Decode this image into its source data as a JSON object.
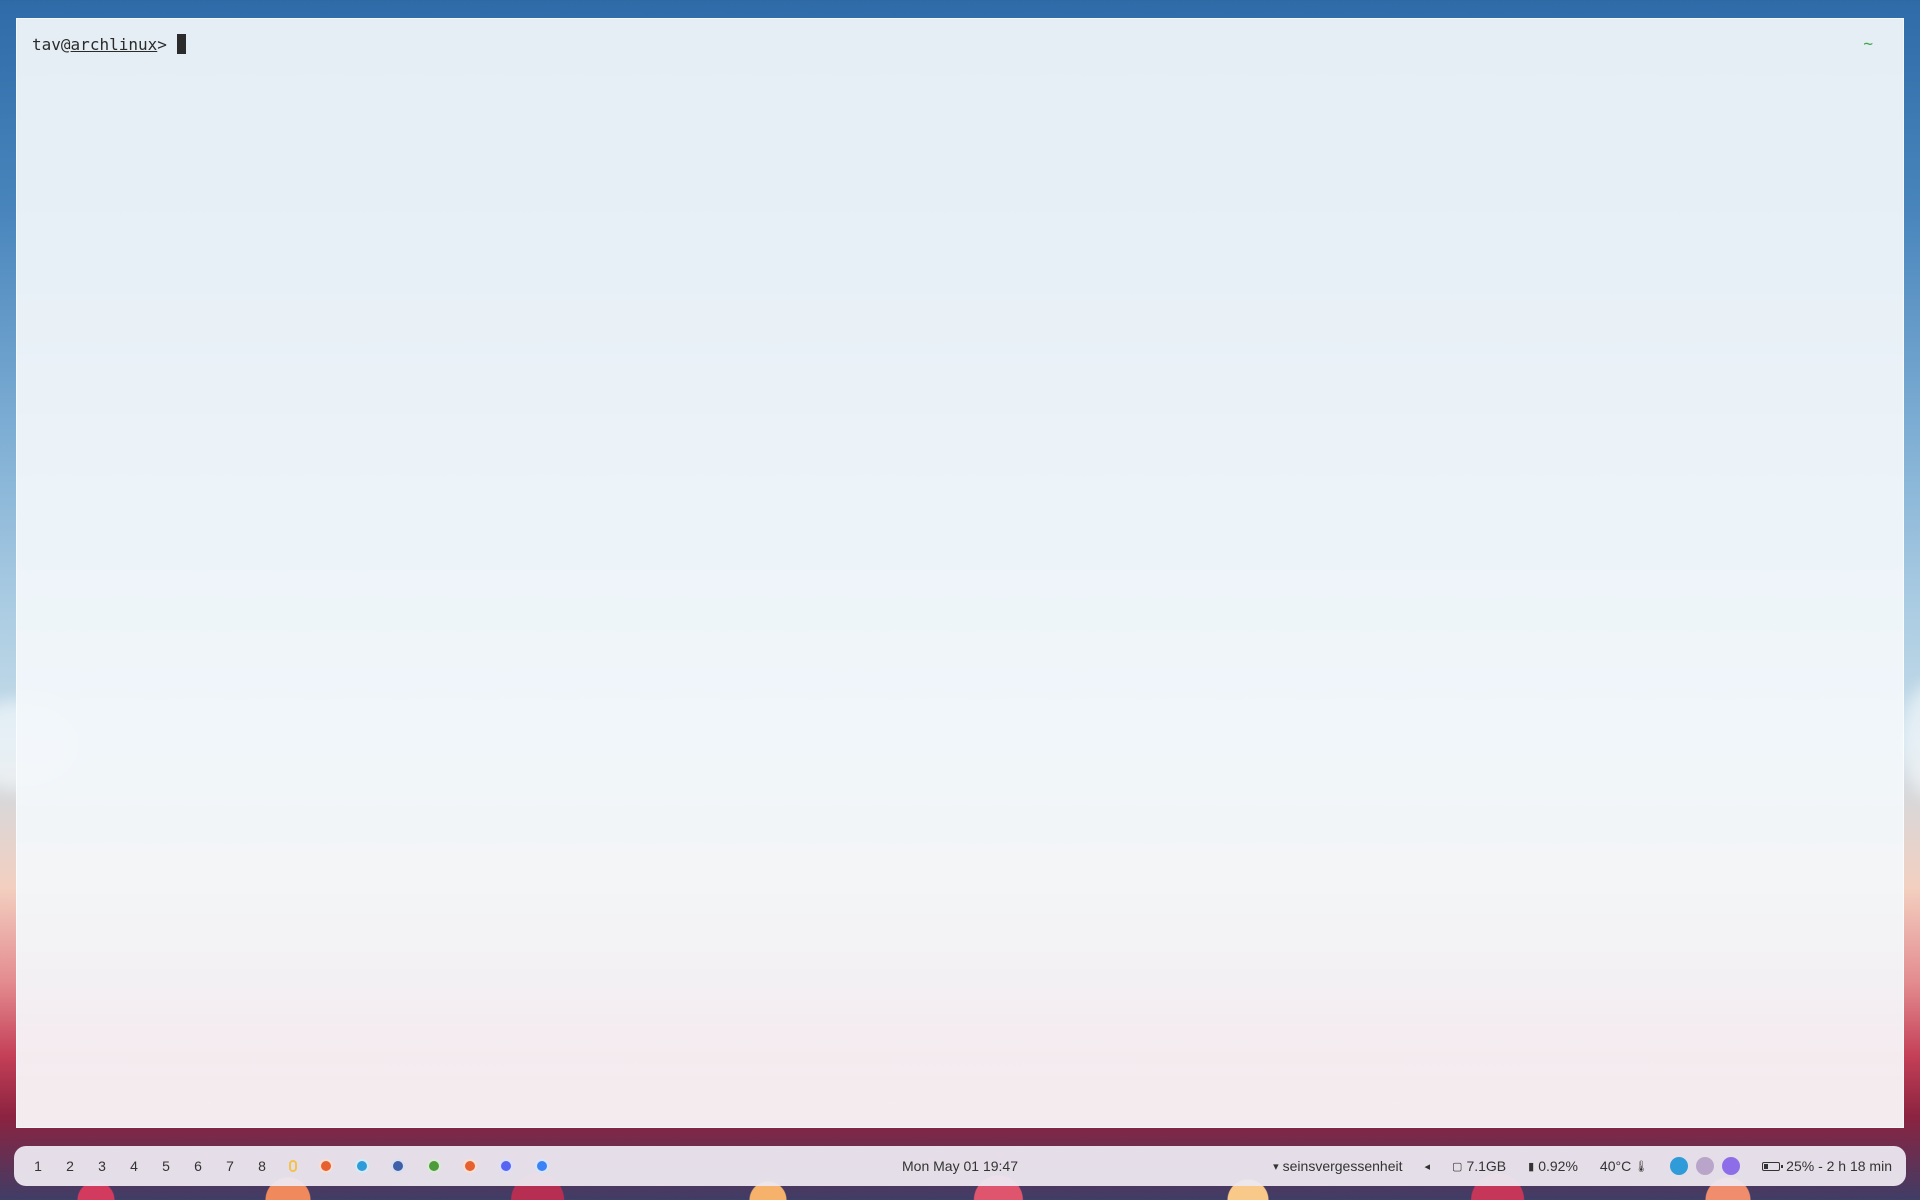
{
  "terminal": {
    "user": "tav",
    "at": "@",
    "host": "archlinux",
    "prompt_symbol": ">",
    "right_prompt": "~"
  },
  "bar": {
    "workspaces": [
      "1",
      "2",
      "3",
      "4",
      "5",
      "6",
      "7",
      "8"
    ],
    "app_icons": [
      {
        "name": "app-idle-icon",
        "color": "#f3c24a"
      },
      {
        "name": "firefox-icon",
        "color": "#e66030"
      },
      {
        "name": "telegram-icon",
        "color": "#2f9bd8"
      },
      {
        "name": "github-icon",
        "color": "#3f5fa8"
      },
      {
        "name": "spotify-icon",
        "color": "#4d9b3a"
      },
      {
        "name": "firefox-icon-2",
        "color": "#e66030"
      },
      {
        "name": "discord-icon",
        "color": "#5865f2"
      },
      {
        "name": "chromium-icon",
        "color": "#3b82f6"
      }
    ],
    "clock": "Mon May 01 19:47",
    "network": {
      "icon": "wifi-icon",
      "label": "seinsvergessenheit"
    },
    "arrow": "◂",
    "memory": {
      "icon": "memory-icon",
      "label": "7.1GB"
    },
    "cpu": {
      "icon": "cpu-icon",
      "label": "0.92%"
    },
    "temperature": {
      "label": "40°C",
      "icon": "thermometer-icon"
    },
    "tray": [
      {
        "name": "telegram-tray-icon",
        "color": "#2f9bd8"
      },
      {
        "name": "discord-tray-icon",
        "color": "#b9a5c9"
      },
      {
        "name": "proton-tray-icon",
        "color": "#8e6ee8"
      }
    ],
    "battery": {
      "icon": "battery-icon",
      "label": "25% - 2 h 18 min"
    },
    "colors": {
      "bar_bg": "#ece8f0",
      "text": "#333333",
      "right_prompt": "#3aa845"
    }
  }
}
